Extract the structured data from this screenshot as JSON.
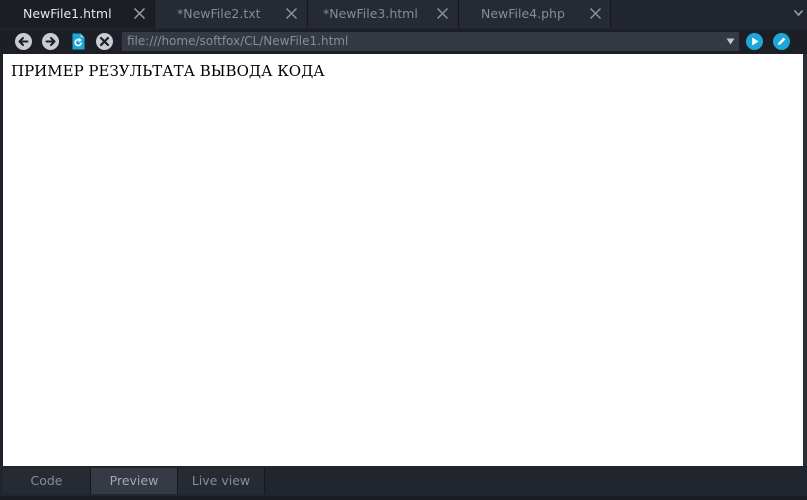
{
  "tabs": [
    {
      "label": "NewFile1.html",
      "active": true
    },
    {
      "label": "*NewFile2.txt",
      "active": false
    },
    {
      "label": "*NewFile3.html",
      "active": false
    },
    {
      "label": "NewFile4.php",
      "active": false
    }
  ],
  "toolbar": {
    "back_icon": "arrow-left-icon",
    "forward_icon": "arrow-right-icon",
    "reload_icon": "document-refresh-icon",
    "stop_icon": "stop-x-icon",
    "url_value": "file:///home/softfox/CL/NewFile1.html",
    "run_icon": "play-icon",
    "edit_icon": "pencil-icon"
  },
  "content": {
    "text": "ПРИМЕР РЕЗУЛЬТАТА ВЫВОДА КОДА"
  },
  "mode_tabs": [
    {
      "label": "Code",
      "active": false
    },
    {
      "label": "Preview",
      "active": true
    },
    {
      "label": "Live view",
      "active": false
    }
  ],
  "colors": {
    "accent": "#1ca7d8",
    "background": "#1e222a",
    "tab_active": "#1b1e25",
    "url_bar": "#353944"
  }
}
